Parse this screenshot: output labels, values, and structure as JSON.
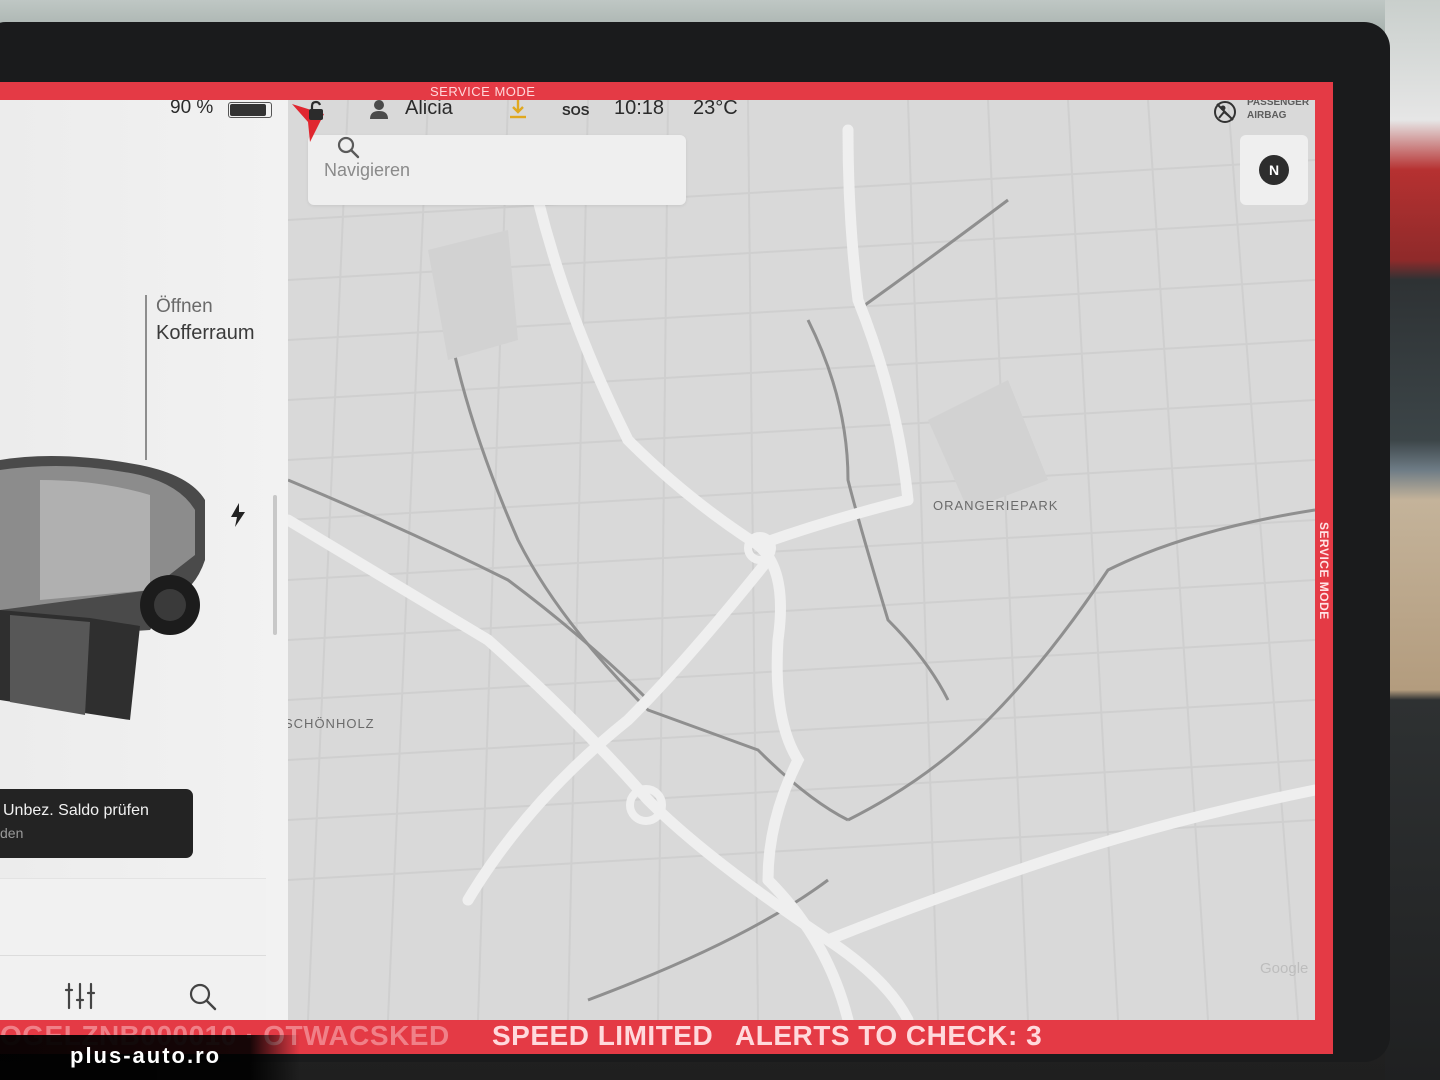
{
  "service_mode": {
    "top_label": "SERVICE MODE",
    "side_label": "SERVICE MODE"
  },
  "status_bar": {
    "battery_percent": "90 %",
    "battery_level": 0.9,
    "user_name": "Alicia",
    "sos_label": "SOS",
    "time": "10:18",
    "temperature": "23°C",
    "airbag_line1": "PASSENGER",
    "airbag_line2": "AIRBAG",
    "icons": [
      "lock-icon",
      "user-icon",
      "download-icon",
      "sos-call-icon",
      "airbag-off-icon"
    ]
  },
  "map": {
    "search_placeholder": "Navigieren",
    "compass_label": "N",
    "labels": {
      "orangeriepark": "ORANGERIEPARK",
      "schonholz": "SCHÖNHOLZ"
    },
    "attribution": "Google",
    "marker_color": "#e0262f"
  },
  "left_panel": {
    "trunk_line1": "Öffnen",
    "trunk_line2": "Kofferraum",
    "toast_title": "Unbez. Saldo prüfen",
    "toast_subtitle": "den",
    "bottom_icons": [
      "sliders-icon",
      "search-icon"
    ]
  },
  "banner": {
    "faded_text": "OGELZNB000010 · OTWACSKED",
    "speed_limited": "SPEED LIMITED",
    "alerts": "ALERTS TO CHECK: 3"
  },
  "watermark": "plus-auto.ro",
  "colors": {
    "service_red": "#e43a45",
    "map_bg": "#d9d9d9",
    "road_major": "#efefef"
  }
}
